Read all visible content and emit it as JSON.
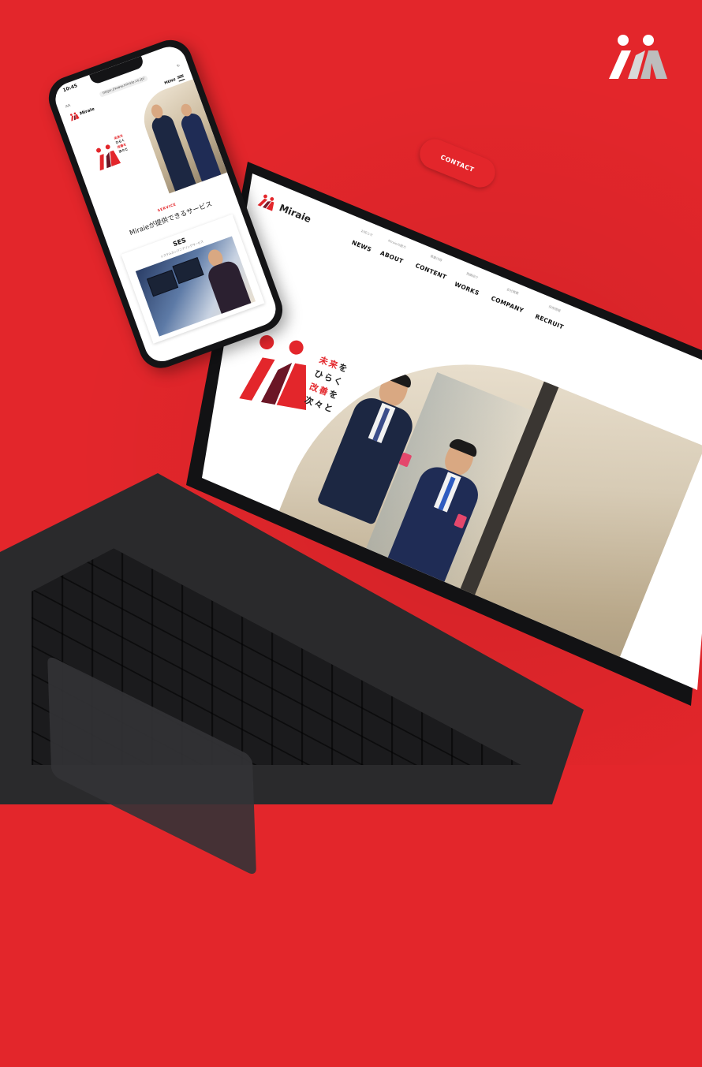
{
  "colors": {
    "brand_red": "#e3262b",
    "navy": "#1c2742",
    "device": "#141416"
  },
  "corner_logo": {
    "icon": "miraie-logo-icon"
  },
  "laptop": {
    "brand": "Miraie",
    "nav": [
      {
        "en": "NEWS",
        "jp": "お知らせ"
      },
      {
        "en": "ABOUT",
        "jp": "Miraieの魅力"
      },
      {
        "en": "CONTENT",
        "jp": "事業内容"
      },
      {
        "en": "WORKS",
        "jp": "実績紹介"
      },
      {
        "en": "COMPANY",
        "jp": "会社概要"
      },
      {
        "en": "RECRUIT",
        "jp": "採用情報"
      }
    ],
    "contact_label": "CONTACT",
    "tagline": [
      {
        "red": "未来",
        "black": "を"
      },
      {
        "red": "",
        "black": "ひらく"
      },
      {
        "red": "改善",
        "black": "を"
      },
      {
        "red": "",
        "black": "次々と"
      }
    ]
  },
  "phone": {
    "time": "10:45",
    "text_size": "AA",
    "url": "https://www.miraie.co.jp/",
    "brand": "Miraie",
    "menu_label": "MENU",
    "tagline": [
      "未来を",
      "ひらく",
      "改善を",
      "次々と"
    ],
    "service_label": "SERVICE",
    "service_title": "Miraieが提供できるサービス",
    "card_title": "SES",
    "card_sub": "システムエンジニアリングサービス"
  }
}
